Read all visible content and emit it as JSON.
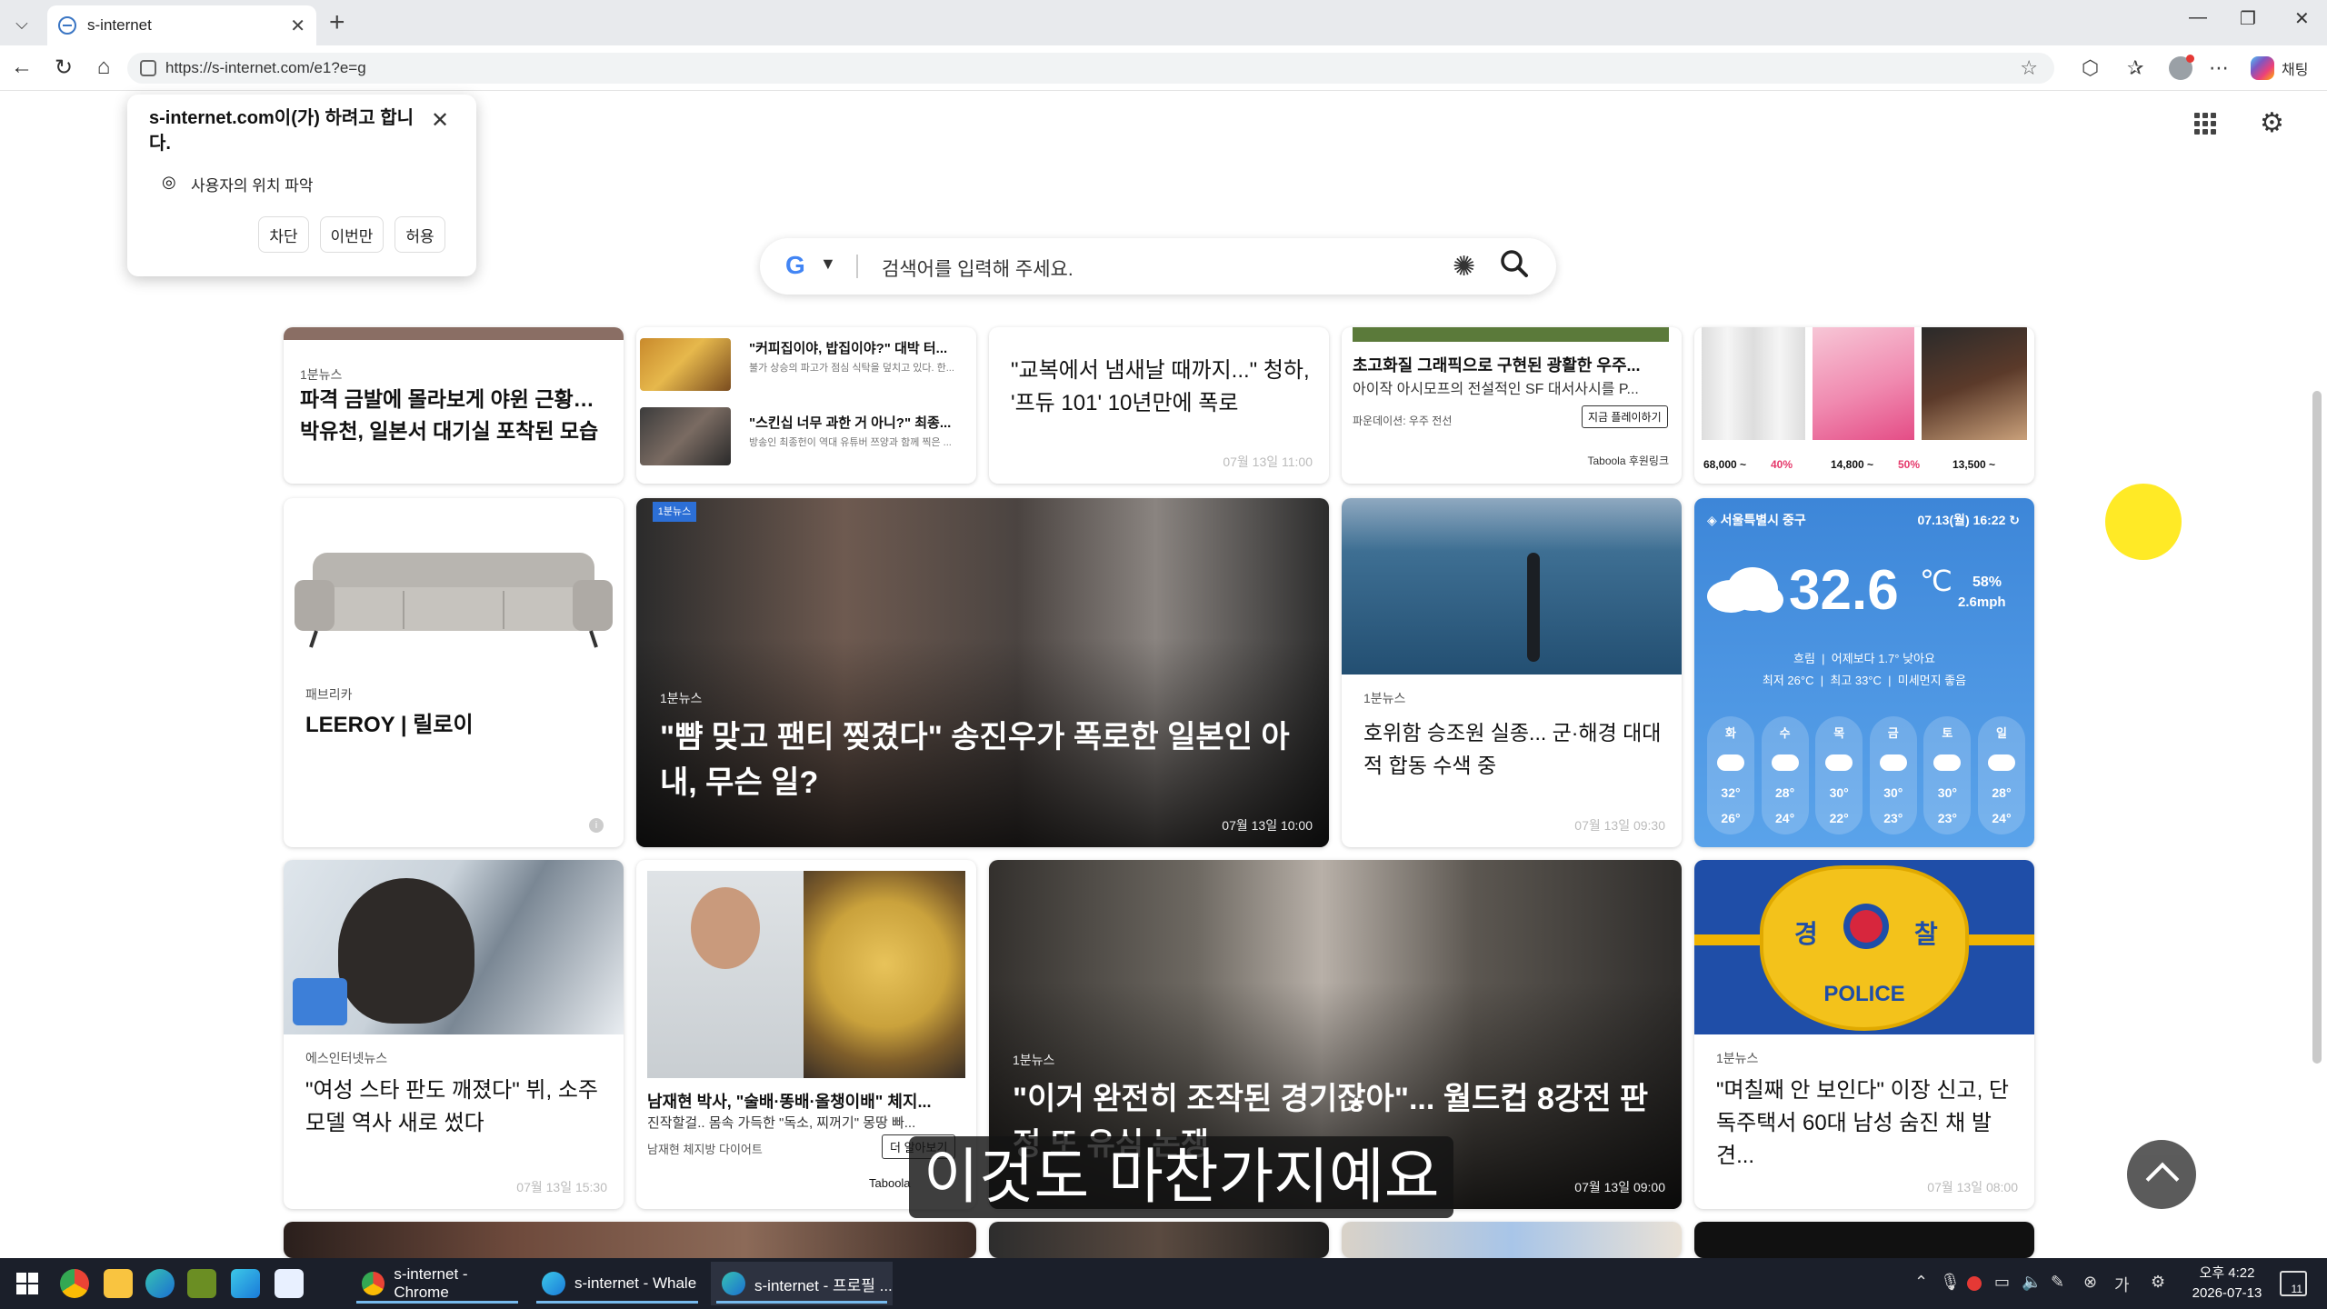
{
  "browser": {
    "tab_title": "s-internet",
    "url": "https://s-internet.com/e1?e=g",
    "side_label": "채팅"
  },
  "permission": {
    "title": "s-internet.com이(가) 하려고 합니다.",
    "item": "사용자의 위치 파악",
    "block": "차단",
    "once": "이번만",
    "allow": "허용"
  },
  "search": {
    "placeholder": "검색어를 입력해 주세요."
  },
  "cards": {
    "r1c1": {
      "source": "1분뉴스",
      "headline": "파격 금발에 몰라보게 야윈 근황… 박유천, 일본서 대기실 포착된 모습"
    },
    "r1c2": {
      "a_title": "\"커피집이야, 밥집이야?\" 대박 터...",
      "a_desc": "불가 상승의 파고가 점심 식탁을 덮치고 있다. 한...",
      "b_title": "\"스킨십 너무 과한 거 아니?\" 최종...",
      "b_desc": "방송인 최종헌이 역대 유튜버 쯔양과 함께 찍은 ..."
    },
    "r1c3": {
      "headline": "\"교복에서 냄새날 때까지...\" 청하, '프듀 101' 10년만에 폭로",
      "date": "07월 13일 11:00"
    },
    "r1c4": {
      "title": "초고화질 그래픽으로 구현된 광활한 우주...",
      "desc": "아이작 아시모프의 전설적인 SF 대서사시를 P...",
      "advertiser": "파운데이션: 우주 전선",
      "cta": "지금 플레이하기",
      "sponsor": "Taboola 후원링크"
    },
    "r1c5": {
      "p1": "68,000 ~",
      "d1": "40%",
      "p2": "14,800 ~",
      "d2": "50%",
      "p3": "13,500 ~"
    },
    "r2c1": {
      "source": "패브리카",
      "headline": "LEEROY | 릴로이"
    },
    "r2c2": {
      "badge": "1분뉴스",
      "source": "1분뉴스",
      "headline": "\"뺨 맞고 팬티 찢겼다\" 송진우가 폭로한 일본인 아내, 무슨 일?",
      "date": "07월 13일 10:00"
    },
    "r2c3": {
      "source": "1분뉴스",
      "headline": "호위함 승조원 실종... 군·해경 대대적 합동 수색 중",
      "date": "07월 13일 09:30"
    },
    "weather": {
      "location": "서울특별시 중구",
      "datetime": "07.13(월) 16:22",
      "temp": "32.6",
      "unit": "℃",
      "humidity": "58%",
      "wind": "2.6mph",
      "status": "흐림",
      "compare": "어제보다 1.7° 낮아요",
      "min": "최저 26°C",
      "max": "최고 33°C",
      "dust": "미세먼지 좋음",
      "days": [
        {
          "day": "화",
          "hi": "32°",
          "lo": "26°"
        },
        {
          "day": "수",
          "hi": "28°",
          "lo": "24°"
        },
        {
          "day": "목",
          "hi": "30°",
          "lo": "22°"
        },
        {
          "day": "금",
          "hi": "30°",
          "lo": "23°"
        },
        {
          "day": "토",
          "hi": "30°",
          "lo": "23°"
        },
        {
          "day": "일",
          "hi": "28°",
          "lo": "24°"
        }
      ]
    },
    "r3c1": {
      "source": "에스인터넷뉴스",
      "headline": "\"여성 스타 판도 깨졌다\" 뷔, 소주 모델 역사 새로 썼다",
      "date": "07월 13일 15:30"
    },
    "r3c2": {
      "title": "남재현 박사, \"술배·똥배·올챙이배\" 체지...",
      "desc": "진작할걸.. 몸속 가득한 \"독소, 찌꺼기\" 몽땅 빠...",
      "advertiser": "남재현 체지방 다이어트",
      "cta": "더 알아보기",
      "sponsor": "Taboola"
    },
    "r3c3": {
      "source": "1분뉴스",
      "headline": "\"이거 완전히 조작된 경기잖아\"... 월드컵 8강전 판정 또 유심 논쟁",
      "date": "07월 13일 09:00"
    },
    "r3c4": {
      "source": "1분뉴스",
      "headline": "\"며칠째 안 보인다\" 이장 신고, 단독주택서 60대 남성 숨진 채 발견...",
      "date": "07월 13일 08:00",
      "police": "POLICE",
      "emblem_l": "경",
      "emblem_r": "찰"
    }
  },
  "caption": "이것도 마찬가지예요",
  "taskbar": {
    "apps": [
      "s-internet - Chrome",
      "s-internet - Whale",
      "s-internet - 프로필 ..."
    ],
    "time": "오후 4:22",
    "date": "2026-07-13",
    "notif": "11"
  }
}
